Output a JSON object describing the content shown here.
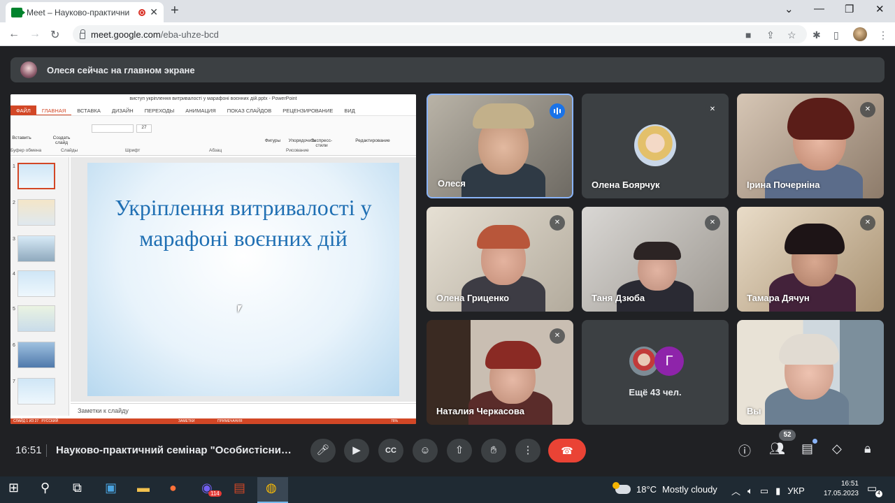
{
  "browser": {
    "tab_title": "Meet – Науково-практични",
    "url_host": "meet.google.com",
    "url_path": "/eba-uhze-bcd"
  },
  "banner": {
    "text": "Олеся сейчас на главном экране"
  },
  "powerpoint": {
    "window_title": "виступ укріплення витривалості у марафоні воєнних дій.pptx - PowerPoint",
    "ribbon_tabs": [
      "ФАЙЛ",
      "ГЛАВНАЯ",
      "ВСТАВКА",
      "ДИЗАЙН",
      "ПЕРЕХОДЫ",
      "АНИМАЦИЯ",
      "ПОКАЗ СЛАЙДОВ",
      "РЕЦЕНЗИРОВАНИЕ",
      "ВИД"
    ],
    "tools": {
      "paste": "Вставить",
      "new_slide": "Создать слайд",
      "shapes": "Фигуры",
      "arrange": "Упорядочить",
      "quick_styles": "Экспресс-стили",
      "editing": "Редактирование"
    },
    "groups": {
      "clipboard": "Буфер обмена",
      "slides": "Слайды",
      "font": "Шрифт",
      "paragraph": "Абзац",
      "drawing": "Рисование"
    },
    "font_size": "27",
    "slide_numbers": [
      "1",
      "2",
      "3",
      "4",
      "5",
      "6",
      "7"
    ],
    "slide_title": "Укріплення витривалості у марафоні воєнних дій",
    "notes_placeholder": "Заметки к слайду",
    "status": {
      "slide_of": "СЛАЙД 1 ИЗ 27",
      "language": "РУССКИЙ",
      "notes": "ЗАМЕТКИ",
      "comments": "ПРИМЕЧАНИЯ",
      "zoom": "76%"
    }
  },
  "participants": [
    {
      "name": "Олеся"
    },
    {
      "name": "Олена Боярчук"
    },
    {
      "name": "Ірина Почерніна"
    },
    {
      "name": "Олена Гриценко"
    },
    {
      "name": "Таня Дзюба"
    },
    {
      "name": "Тамара Дячун"
    },
    {
      "name": "Наталия Черкасова"
    },
    {
      "name": "Вы"
    }
  ],
  "more_participants": {
    "initial": "Г",
    "label": "Ещё 43 чел."
  },
  "bottom_bar": {
    "time": "16:51",
    "meeting_title": "Науково-практичний семінар \"Особистісний...",
    "participant_count": "52"
  },
  "taskbar": {
    "viber_badge": "114",
    "temperature": "18°C",
    "weather": "Mostly cloudy",
    "language": "УКР",
    "time": "16:51",
    "date": "17.05.2023",
    "notifications": "4"
  },
  "colors": {
    "meet_bg": "#202124",
    "end_call": "#ea4335",
    "ppt_accent": "#d24726",
    "slide_title": "#1f6fb3"
  }
}
